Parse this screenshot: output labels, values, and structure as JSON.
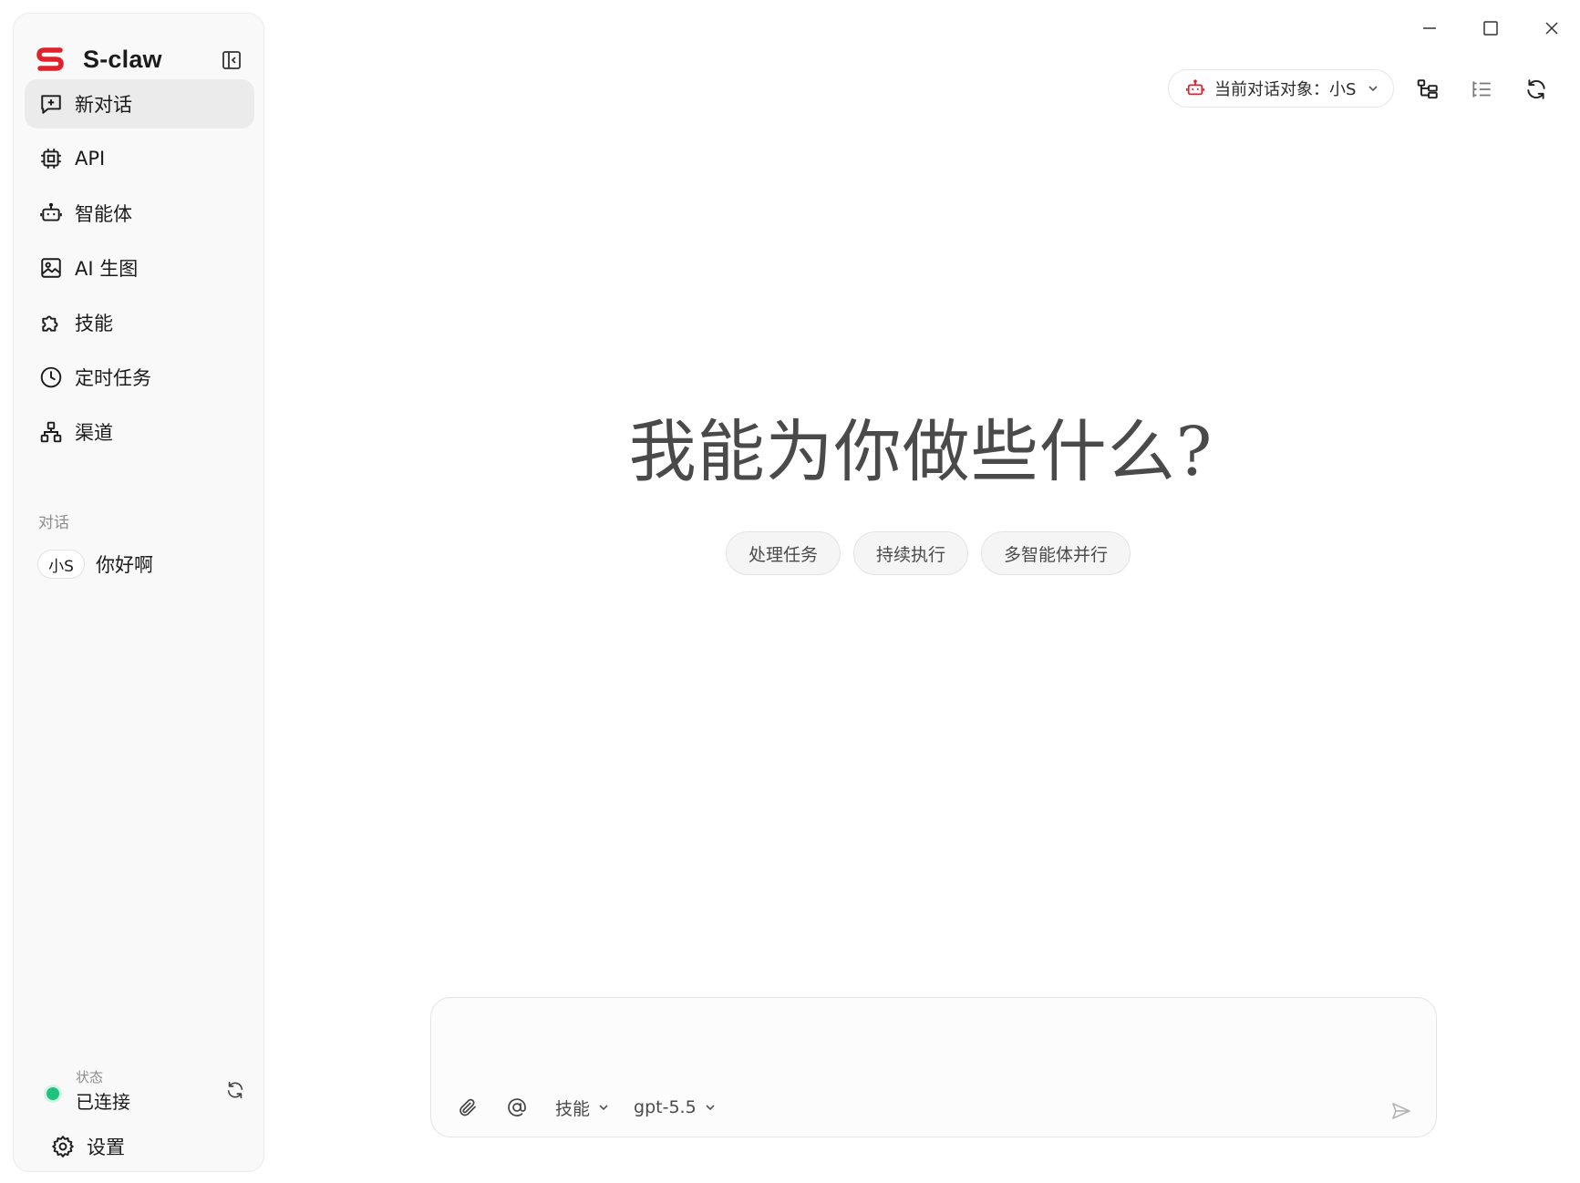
{
  "app": {
    "name": "S-claw",
    "brand_color": "#e0202a",
    "collapse_icon": "sidebar-collapse-icon"
  },
  "window_controls": {
    "minimize": "minimize-icon",
    "maximize": "maximize-icon",
    "close": "close-icon"
  },
  "sidebar": {
    "items": [
      {
        "label": "新对话",
        "icon": "new-chat-icon",
        "active": true
      },
      {
        "label": "API",
        "icon": "chip-icon"
      },
      {
        "label": "智能体",
        "icon": "robot-icon"
      },
      {
        "label": "AI 生图",
        "icon": "image-icon"
      },
      {
        "label": "技能",
        "icon": "puzzle-icon"
      },
      {
        "label": "定时任务",
        "icon": "clock-icon"
      },
      {
        "label": "渠道",
        "icon": "network-icon"
      }
    ],
    "section_label": "对话",
    "conversations": [
      {
        "badge": "小S",
        "title": "你好啊"
      }
    ],
    "status": {
      "caption": "状态",
      "value": "已连接",
      "color": "#1ec27a"
    },
    "settings_label": "设置"
  },
  "toolbar": {
    "target_label": "当前对话对象：小S",
    "target_icon": "robot-icon",
    "target_icon_color": "#e0202a",
    "buttons": [
      "tree-view-icon",
      "outline-list-icon",
      "refresh-icon"
    ]
  },
  "main": {
    "hero_title": "我能为你做些什么?",
    "chips": [
      "处理任务",
      "持续执行",
      "多智能体并行"
    ]
  },
  "composer": {
    "placeholder": "",
    "attach_icon": "paperclip-icon",
    "mention_icon": "at-icon",
    "skills_label": "技能",
    "model_label": "gpt-5.5",
    "send_icon": "send-icon"
  }
}
